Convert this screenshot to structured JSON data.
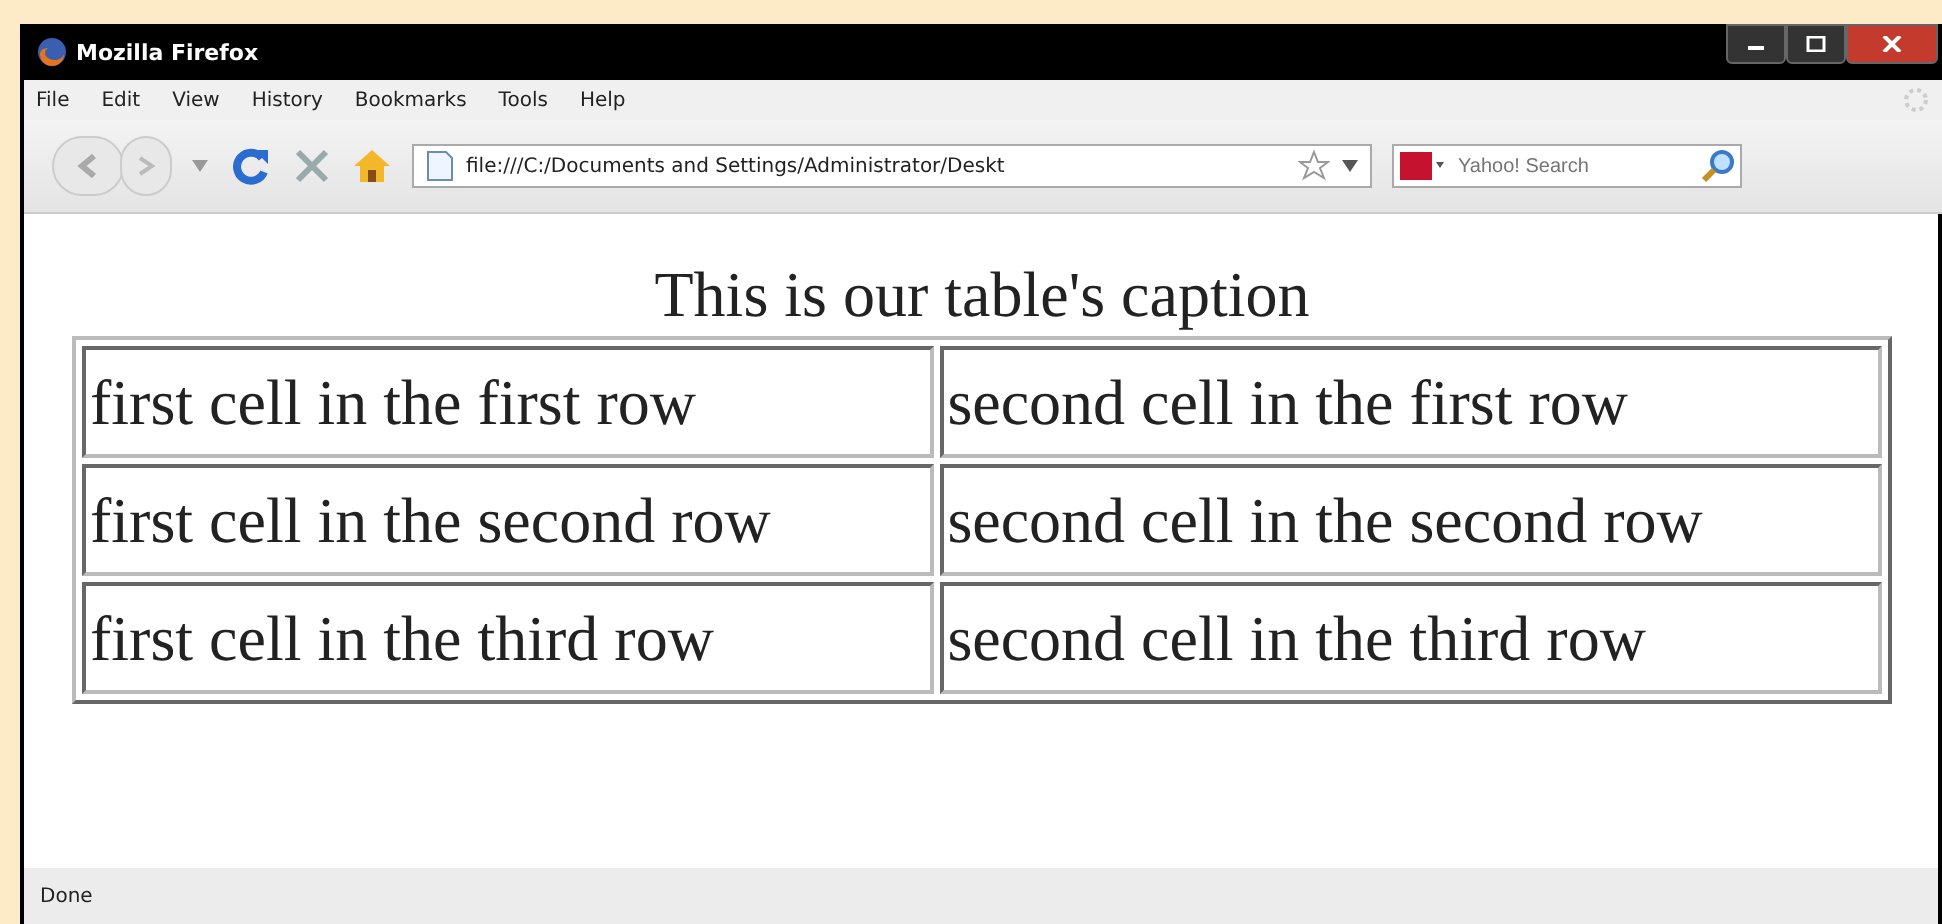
{
  "window": {
    "title": "Mozilla Firefox"
  },
  "menu": [
    "File",
    "Edit",
    "View",
    "History",
    "Bookmarks",
    "Tools",
    "Help"
  ],
  "toolbar": {
    "address": "file:///C:/Documents and Settings/Administrator/Deskt",
    "search": {
      "placeholder": "Yahoo! Search"
    }
  },
  "table": {
    "caption": "This is our table's caption",
    "rows": [
      [
        "first cell in the first row",
        "second cell in the first row"
      ],
      [
        "first cell in the second row",
        "second cell in the second row"
      ],
      [
        "first cell in the third row",
        "second cell in the third row"
      ]
    ]
  },
  "status_bar": "Done"
}
